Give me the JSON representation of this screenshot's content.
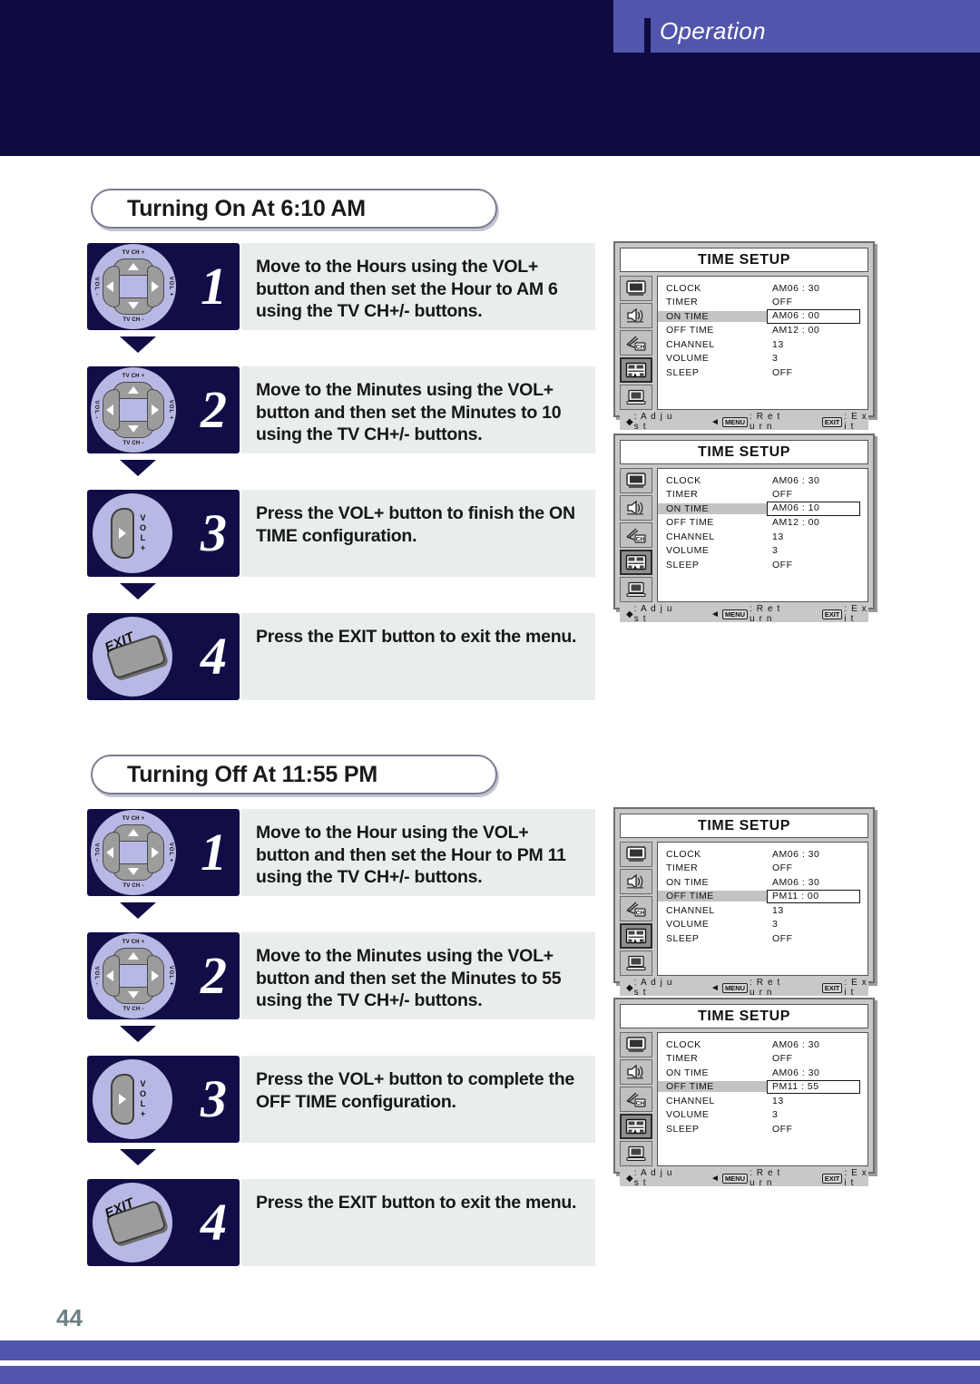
{
  "header": {
    "title": "Operation"
  },
  "page": {
    "number": "44"
  },
  "sections": [
    {
      "title": "Turning On At 6:10 AM",
      "steps": [
        {
          "number": "1",
          "control": "dpad",
          "text": "Move to the Hours using the VOL+ button and then set the Hour to AM 6 using the TV CH+/- buttons."
        },
        {
          "number": "2",
          "control": "dpad",
          "text": "Move to the Minutes using the VOL+ button and then set the Minutes to 10 using the TV CH+/- buttons."
        },
        {
          "number": "3",
          "control": "vol",
          "text": "Press the VOL+ button to finish the ON TIME configuration."
        },
        {
          "number": "4",
          "control": "exit",
          "text": "Press the EXIT button to exit the menu."
        }
      ]
    },
    {
      "title": "Turning Off At 11:55 PM",
      "steps": [
        {
          "number": "1",
          "control": "dpad",
          "text": "Move to the Hour using the VOL+ button and then set the Hour to PM 11 using the TV CH+/- buttons."
        },
        {
          "number": "2",
          "control": "dpad",
          "text": "Move to the Minutes using the VOL+ button and then set the Minutes to 55 using the TV CH+/- buttons."
        },
        {
          "number": "3",
          "control": "vol",
          "text": "Press the VOL+ button to complete the OFF TIME configuration."
        },
        {
          "number": "4",
          "control": "exit",
          "text": "Press the EXIT button to exit the menu."
        }
      ]
    }
  ],
  "dpad": {
    "up_label": "TV CH +",
    "down_label": "TV CH -",
    "left_label": "VOL -",
    "right_label": "VOL +"
  },
  "vol_button": {
    "label_lines": "V\nO\nL\n+"
  },
  "exit_button": {
    "label": "EXIT"
  },
  "osd_menus": [
    {
      "title": "TIME SETUP",
      "rows": [
        {
          "label": "CLOCK",
          "value": "AM06 : 30",
          "highlighted": false,
          "marked": ""
        },
        {
          "label": "TIMER",
          "value": "OFF",
          "highlighted": false,
          "marked": ""
        },
        {
          "label": "ON TIME",
          "value": "AM06 : 00",
          "highlighted": true,
          "marked": "AM06"
        },
        {
          "label": "OFF TIME",
          "value": "AM12 : 00",
          "highlighted": false,
          "marked": ""
        },
        {
          "label": "CHANNEL",
          "value": "13",
          "highlighted": false,
          "marked": ""
        },
        {
          "label": "VOLUME",
          "value": "3",
          "highlighted": false,
          "marked": ""
        },
        {
          "label": "SLEEP",
          "value": "OFF",
          "highlighted": false,
          "marked": ""
        }
      ]
    },
    {
      "title": "TIME SETUP",
      "rows": [
        {
          "label": "CLOCK",
          "value": "AM06 : 30",
          "highlighted": false,
          "marked": ""
        },
        {
          "label": "TIMER",
          "value": "OFF",
          "highlighted": false,
          "marked": ""
        },
        {
          "label": "ON TIME",
          "value": "AM06 : 10",
          "highlighted": true,
          "marked": "10"
        },
        {
          "label": "OFF TIME",
          "value": "AM12 : 00",
          "highlighted": false,
          "marked": ""
        },
        {
          "label": "CHANNEL",
          "value": "13",
          "highlighted": false,
          "marked": ""
        },
        {
          "label": "VOLUME",
          "value": "3",
          "highlighted": false,
          "marked": ""
        },
        {
          "label": "SLEEP",
          "value": "OFF",
          "highlighted": false,
          "marked": ""
        }
      ]
    },
    {
      "title": "TIME SETUP",
      "rows": [
        {
          "label": "CLOCK",
          "value": "AM06 : 30",
          "highlighted": false,
          "marked": ""
        },
        {
          "label": "TIMER",
          "value": "OFF",
          "highlighted": false,
          "marked": ""
        },
        {
          "label": "ON TIME",
          "value": "AM06 : 30",
          "highlighted": false,
          "marked": ""
        },
        {
          "label": "OFF TIME",
          "value": "PM11 : 00",
          "highlighted": true,
          "marked": "PM11"
        },
        {
          "label": "CHANNEL",
          "value": "13",
          "highlighted": false,
          "marked": ""
        },
        {
          "label": "VOLUME",
          "value": "3",
          "highlighted": false,
          "marked": ""
        },
        {
          "label": "SLEEP",
          "value": "OFF",
          "highlighted": false,
          "marked": ""
        }
      ]
    },
    {
      "title": "TIME SETUP",
      "rows": [
        {
          "label": "CLOCK",
          "value": "AM06 : 30",
          "highlighted": false,
          "marked": ""
        },
        {
          "label": "TIMER",
          "value": "OFF",
          "highlighted": false,
          "marked": ""
        },
        {
          "label": "ON TIME",
          "value": "AM06 : 30",
          "highlighted": false,
          "marked": ""
        },
        {
          "label": "OFF TIME",
          "value": "PM11 : 55",
          "highlighted": true,
          "marked": "55"
        },
        {
          "label": "CHANNEL",
          "value": "13",
          "highlighted": false,
          "marked": ""
        },
        {
          "label": "VOLUME",
          "value": "3",
          "highlighted": false,
          "marked": ""
        },
        {
          "label": "SLEEP",
          "value": "OFF",
          "highlighted": false,
          "marked": ""
        }
      ]
    }
  ],
  "osd_footer": {
    "adjust": ": A d j u s t",
    "menu_key": "MENU",
    "return": ": R e t u r n",
    "exit_key": "EXIT",
    "exit": ": E x i t"
  },
  "osd_icon_names": [
    "tv-picture-icon",
    "speaker-audio-icon",
    "antenna-channel-icon",
    "timer-clock-icon",
    "pc-monitor-icon"
  ],
  "osd_selected_icon_index": 3,
  "colors": {
    "navy": "#0c0a40",
    "purple": "#5255ac",
    "panel_gray": "#e9edee",
    "knob_lavender": "#b8b8e4",
    "page_number": "#6b7f85"
  }
}
